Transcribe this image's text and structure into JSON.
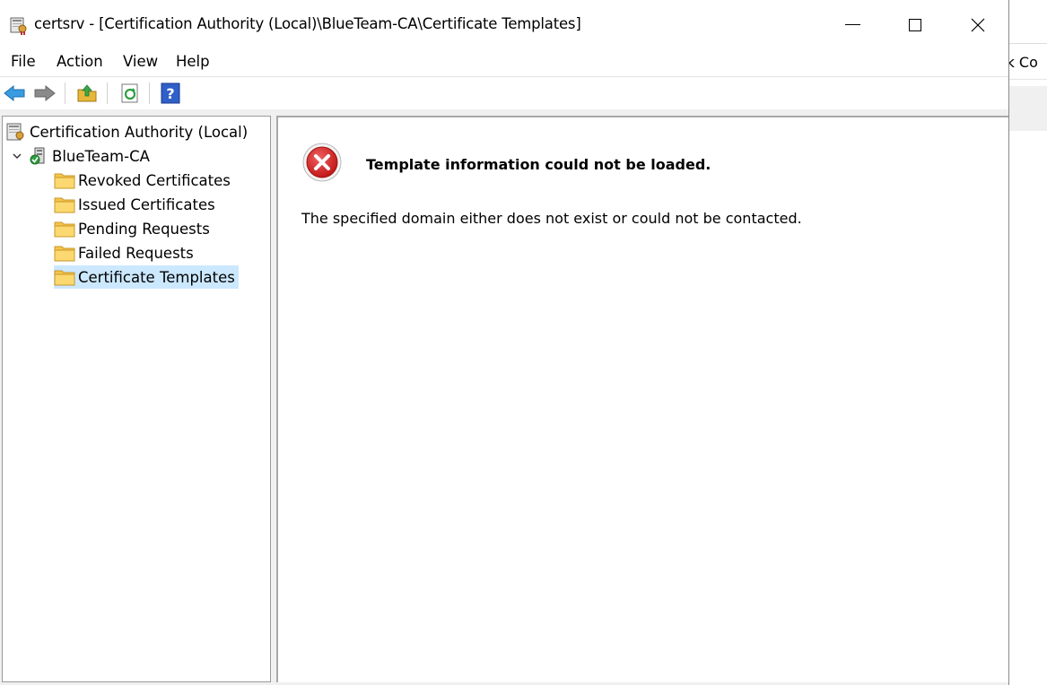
{
  "window": {
    "title": "certsrv - [Certification Authority (Local)\\BlueTeam-CA\\Certificate Templates]"
  },
  "background_window": {
    "partial_text": "rk Co"
  },
  "menu": [
    {
      "label": "File"
    },
    {
      "label": "Action"
    },
    {
      "label": "View"
    },
    {
      "label": "Help"
    }
  ],
  "toolbar": {
    "icons": [
      "back-arrow-icon",
      "forward-arrow-icon",
      "up-folder-icon",
      "refresh-icon",
      "help-icon"
    ]
  },
  "tree": {
    "root": "Certification Authority (Local)",
    "ca": "BlueTeam-CA",
    "children": [
      {
        "label": "Revoked Certificates"
      },
      {
        "label": "Issued Certificates"
      },
      {
        "label": "Pending Requests"
      },
      {
        "label": "Failed Requests"
      },
      {
        "label": "Certificate Templates"
      }
    ],
    "selected_index": 4
  },
  "result": {
    "error_title": "Template information could not be loaded.",
    "error_message": "The specified domain either does not exist or could not be contacted."
  },
  "colors": {
    "selection": "#cce8ff",
    "folder": "#f5c54a",
    "error_red": "#d32626"
  }
}
